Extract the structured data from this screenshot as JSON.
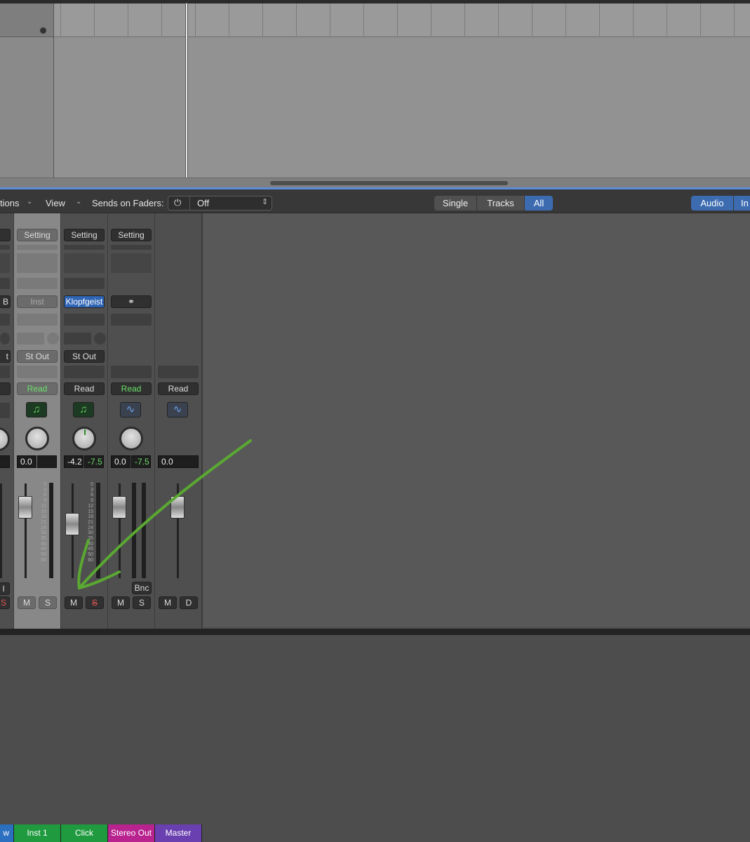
{
  "arrange": {
    "record_dot_label": ""
  },
  "toolbar": {
    "options_label": "tions",
    "view_label": "View",
    "sends_label": "Sends on Faders:",
    "sends_value": "Off",
    "filter_single": "Single",
    "filter_tracks": "Tracks",
    "filter_all": "All",
    "type_audio": "Audio",
    "type_inst": "In"
  },
  "strips": {
    "partial": {
      "lbl_setting": "",
      "lbl_input": "B",
      "lbl_output": "t",
      "readout": "",
      "name": "w",
      "solo": "I"
    },
    "inst1": {
      "setting": "Setting",
      "input": "Inst",
      "output": "St Out",
      "automation": "Read",
      "vol": "0.0",
      "pan": "",
      "mute": "M",
      "solo": "S",
      "name": "Inst 1",
      "color": "#1f9a3e",
      "icon": "music-note"
    },
    "click": {
      "setting": "Setting",
      "input": "Klopfgeist",
      "output": "St Out",
      "automation": "Read",
      "vol": "-4.2",
      "peak": "-7.5",
      "mute": "M",
      "solo": "S",
      "name": "Click",
      "color": "#1f9a3e",
      "icon": "music-note"
    },
    "stereo_out": {
      "setting": "Setting",
      "output_icon": "stereo-link",
      "automation": "Read",
      "vol": "0.0",
      "peak": "-7.5",
      "bnc": "Bnc",
      "mute": "M",
      "solo": "S",
      "name": "Stereo Out",
      "color": "#b8238f",
      "icon": "waveform"
    },
    "master": {
      "automation": "Read",
      "vol": "0.0",
      "mute": "M",
      "dim": "D",
      "name": "Master",
      "color": "#6a3fb0",
      "icon": "waveform"
    }
  },
  "scale_ticks": [
    "0",
    "3",
    "6",
    "9",
    "12",
    "15",
    "18",
    "21",
    "24",
    "30",
    "35",
    "40",
    "45",
    "50",
    "60"
  ],
  "accent": "#3c6bb0",
  "annotation_color": "#5aa832"
}
